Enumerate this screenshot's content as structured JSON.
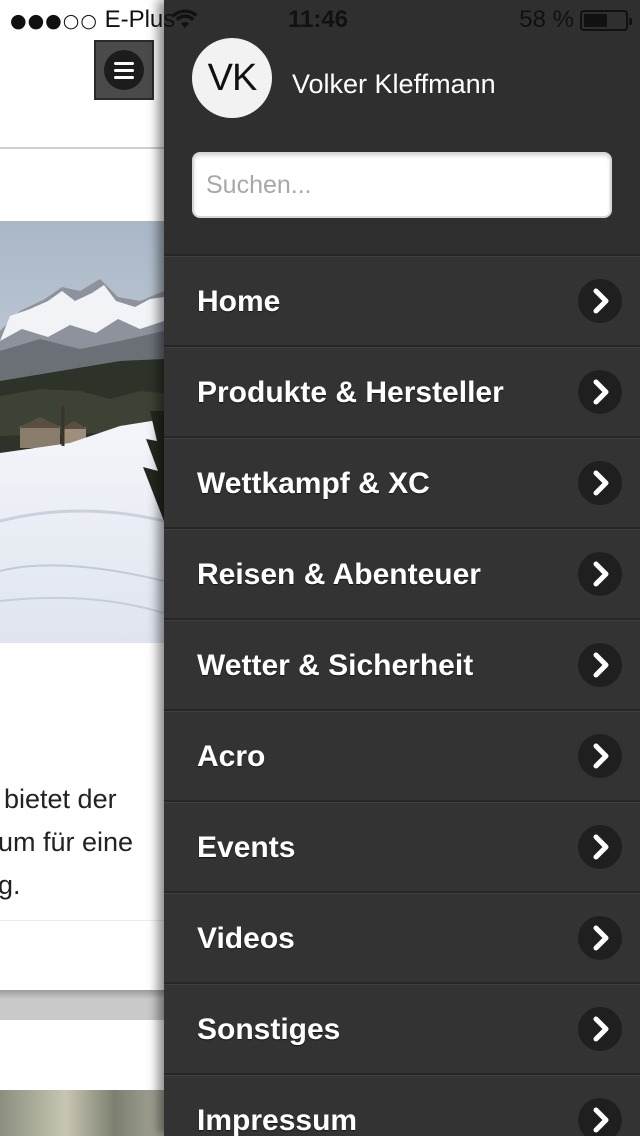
{
  "status_bar": {
    "signal_dots": "●●●○○",
    "carrier": "E-Plus",
    "time": "11:46",
    "battery_text": "58 %",
    "battery_level": 0.58
  },
  "page": {
    "text_lines": [
      "bietet der",
      "um für eine",
      "g."
    ]
  },
  "drawer": {
    "avatar_initials": "VK",
    "user_name": "Volker Kleffmann",
    "search_placeholder": "Suchen...",
    "menu_items": [
      {
        "label": "Home"
      },
      {
        "label": "Produkte & Hersteller"
      },
      {
        "label": "Wettkampf & XC"
      },
      {
        "label": "Reisen & Abenteuer"
      },
      {
        "label": "Wetter & Sicherheit"
      },
      {
        "label": "Acro"
      },
      {
        "label": "Events"
      },
      {
        "label": "Videos"
      },
      {
        "label": "Sonstiges"
      },
      {
        "label": "Impressum"
      }
    ]
  },
  "icons": {
    "menu": "hamburger-menu-icon",
    "chevron": "chevron-right-icon",
    "wifi": "wifi-icon",
    "battery": "battery-icon"
  },
  "colors": {
    "drawer_bg": "#2f2f2f",
    "menu_item_bg": "#333333",
    "chevron_bg": "#1f1f1f",
    "text_on_dark": "#ffffff"
  }
}
